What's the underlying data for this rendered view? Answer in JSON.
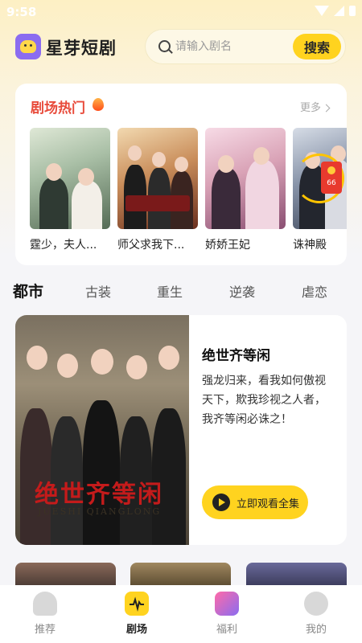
{
  "status_bar": {
    "time": "9:58"
  },
  "header": {
    "app_name": "星芽短剧",
    "search_placeholder": "请输入剧名",
    "search_button": "搜索"
  },
  "hot_section": {
    "title": "剧场热门",
    "more": "更多",
    "items": [
      {
        "title": "霆少，夫人..."
      },
      {
        "title": "师父求我下..."
      },
      {
        "title": "娇娇王妃"
      },
      {
        "title": "诛神殿"
      }
    ],
    "reward_count": "66"
  },
  "category_tabs": [
    {
      "label": "都市",
      "active": true
    },
    {
      "label": "古装",
      "active": false
    },
    {
      "label": "重生",
      "active": false
    },
    {
      "label": "逆袭",
      "active": false
    },
    {
      "label": "虐恋",
      "active": false
    }
  ],
  "featured": {
    "title": "绝世齐等闲",
    "description": "强龙归来，看我如何傲视天下，欺我珍视之人者，我齐等闲必诛之！",
    "watch_button": "立即观看全集",
    "poster_title": "绝世齐等闲",
    "poster_subtitle": "JUESHI QIANGLONG"
  },
  "bottom_nav": [
    {
      "label": "推荐",
      "icon": "home-icon",
      "active": false
    },
    {
      "label": "剧场",
      "icon": "theater-icon",
      "active": true
    },
    {
      "label": "福利",
      "icon": "gift-icon",
      "active": false
    },
    {
      "label": "我的",
      "icon": "profile-icon",
      "active": false
    }
  ],
  "colors": {
    "accent": "#ffd31f",
    "hot_title": "#e84a3a"
  }
}
